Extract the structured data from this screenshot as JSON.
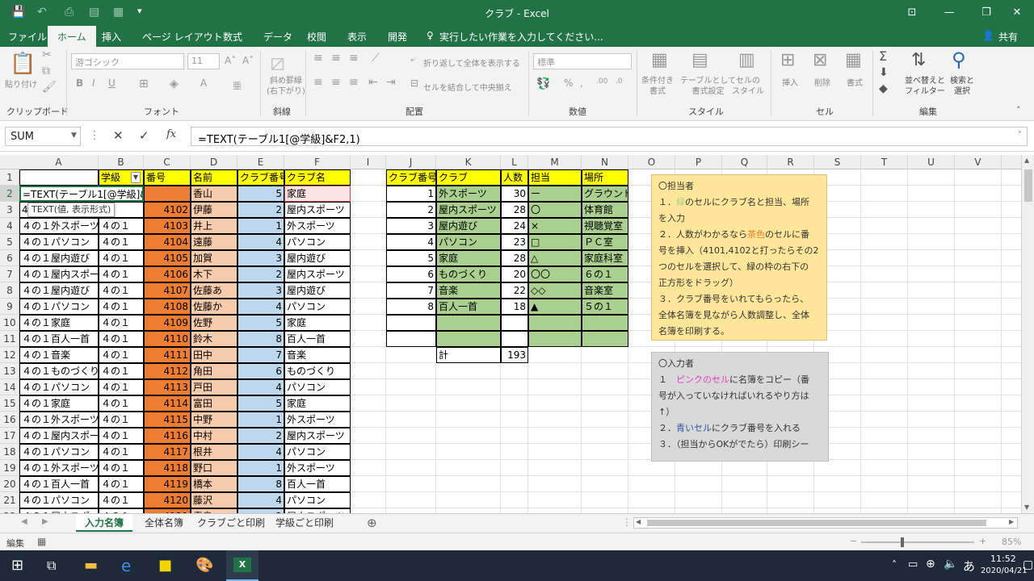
{
  "window": {
    "title": "クラブ - Excel"
  },
  "tabs": [
    "ファイル",
    "ホーム",
    "挿入",
    "ページ レイアウト",
    "数式",
    "データ",
    "校閲",
    "表示",
    "開発"
  ],
  "tell_me": "実行したい作業を入力してください...",
  "share": "共有",
  "ribbon": {
    "paste": "貼り付け",
    "clipboard": "クリップボード",
    "font_name": "游ゴシック",
    "font_size": "11",
    "font_group": "フォント",
    "diag_border": "斜め罫線\n(右下がり)",
    "diag_group": "斜線",
    "wrap": "折り返して全体を表示する",
    "merge": "セルを結合して中央揃え",
    "align_group": "配置",
    "number_format": "標準",
    "number_group": "数値",
    "cond_format": "条件付き\n書式",
    "table_format": "テーブルとして\n書式設定",
    "cell_style": "セルの\nスタイル",
    "style_group": "スタイル",
    "insert": "挿入",
    "delete": "削除",
    "format": "書式",
    "cells_group": "セル",
    "sort": "並べ替えと\nフィルター",
    "find": "検索と\n選択",
    "edit_group": "編集"
  },
  "formula_bar": {
    "name_box": "SUM",
    "formula": "=TEXT(テーブル1[@学級]&F2,1)"
  },
  "columns": [
    "A",
    "B",
    "C",
    "D",
    "E",
    "F",
    "I",
    "J",
    "K",
    "L",
    "M",
    "N",
    "O",
    "P",
    "Q",
    "R",
    "S",
    "T",
    "U",
    "V"
  ],
  "rows": [
    "1",
    "2",
    "3",
    "4",
    "5",
    "6",
    "7",
    "8",
    "9",
    "10",
    "11",
    "12",
    "13",
    "14",
    "15",
    "16",
    "17",
    "18",
    "19",
    "20",
    "21",
    "22"
  ],
  "table1": {
    "headers": [
      "",
      "学級",
      "番号",
      "名前",
      "クラブ番号",
      "クラブ名"
    ],
    "editing_cell": "=TEXT(テーブル1[@学級]&F2,1)",
    "tooltip": "TEXT(値, 表示形式)",
    "row2": [
      "",
      "",
      "",
      "香山",
      "5",
      "家庭"
    ],
    "rows": [
      [
        "4",
        "",
        "4102",
        "伊藤",
        "2",
        "屋内スポーツ"
      ],
      [
        "４の１外スポーツ",
        "４の１",
        "4103",
        "井上",
        "1",
        "外スポーツ"
      ],
      [
        "４の１パソコン",
        "４の１",
        "4104",
        "遠藤",
        "4",
        "パソコン"
      ],
      [
        "４の１屋内遊び",
        "４の１",
        "4105",
        "加賀",
        "3",
        "屋内遊び"
      ],
      [
        "４の１屋内スポーツ",
        "４の１",
        "4106",
        "木下",
        "2",
        "屋内スポーツ"
      ],
      [
        "４の１屋内遊び",
        "４の１",
        "4107",
        "佐藤あ",
        "3",
        "屋内遊び"
      ],
      [
        "４の１パソコン",
        "４の１",
        "4108",
        "佐藤か",
        "4",
        "パソコン"
      ],
      [
        "４の１家庭",
        "４の１",
        "4109",
        "佐野",
        "5",
        "家庭"
      ],
      [
        "４の１百人一首",
        "４の１",
        "4110",
        "鈴木",
        "8",
        "百人一首"
      ],
      [
        "４の１音楽",
        "４の１",
        "4111",
        "田中",
        "7",
        "音楽"
      ],
      [
        "４の１ものづくり",
        "４の１",
        "4112",
        "角田",
        "6",
        "ものづくり"
      ],
      [
        "４の１パソコン",
        "４の１",
        "4113",
        "戸田",
        "4",
        "パソコン"
      ],
      [
        "４の１家庭",
        "４の１",
        "4114",
        "富田",
        "5",
        "家庭"
      ],
      [
        "４の１外スポーツ",
        "４の１",
        "4115",
        "中野",
        "1",
        "外スポーツ"
      ],
      [
        "４の１屋内スポーツ",
        "４の１",
        "4116",
        "中村",
        "2",
        "屋内スポーツ"
      ],
      [
        "４の１パソコン",
        "４の１",
        "4117",
        "根井",
        "4",
        "パソコン"
      ],
      [
        "４の１外スポーツ",
        "４の１",
        "4118",
        "野口",
        "1",
        "外スポーツ"
      ],
      [
        "４の１百人一首",
        "４の１",
        "4119",
        "橋本",
        "8",
        "百人一首"
      ],
      [
        "４の１パソコン",
        "４の１",
        "4120",
        "藤沢",
        "4",
        "パソコン"
      ],
      [
        "４の１屋内スポーツ",
        "４の１",
        "4121",
        "青島",
        "2",
        "屋内スポーツ"
      ]
    ]
  },
  "club_table": {
    "headers": [
      "クラブ番号",
      "クラブ",
      "人数",
      "担当",
      "場所"
    ],
    "rows": [
      [
        "1",
        "外スポーツ",
        "30",
        "ー",
        "グラウンド"
      ],
      [
        "2",
        "屋内スポーツ",
        "28",
        "〇",
        "体育館"
      ],
      [
        "3",
        "屋内遊び",
        "24",
        "×",
        "視聴覚室"
      ],
      [
        "4",
        "パソコン",
        "23",
        "□",
        "ＰＣ室"
      ],
      [
        "5",
        "家庭",
        "28",
        "△",
        "家庭科室"
      ],
      [
        "6",
        "ものづくり",
        "20",
        "〇〇",
        "６の１"
      ],
      [
        "7",
        "音楽",
        "22",
        "◇◇",
        "音楽室"
      ],
      [
        "8",
        "百人一首",
        "18",
        "▲",
        "５の１"
      ],
      [
        "",
        "",
        "",
        "",
        ""
      ],
      [
        "",
        "",
        "",
        "",
        ""
      ]
    ],
    "total_label": "計",
    "total_value": "193"
  },
  "note1": {
    "title": "〇担当者",
    "l1a": "１．",
    "l1b": "緑",
    "l1c": "のセルにクラブ名と担当、場所",
    "l2": "を入力",
    "l3a": "２．人数がわかるなら",
    "l3b": "茶色",
    "l3c": "のセルに番",
    "l4": "号を挿入（4101,4102と打ったらその2",
    "l5": "つのセルを選択して、緑の枠の右下の",
    "l6": "正方形をドラッグ）",
    "l7": "３．クラブ番号をいれてもらったら、",
    "l8": "全体名簿を見ながら人数調整し、全体",
    "l9": "名簿を印刷する。"
  },
  "note2": {
    "title": "〇入力者",
    "l1a": "１　",
    "l1b": "ピンクのセル",
    "l1c": "に名簿をコピー（番",
    "l2": "号が入っていなければいれるやり方は",
    "l3": "↑）",
    "l4a": "２．",
    "l4b": "青いセル",
    "l4c": "にクラブ番号を入れる",
    "l5": "３．（担当からOKがでたら）印刷シー"
  },
  "sheets": [
    "入力名簿",
    "全体名簿",
    "クラブごと印刷",
    "学級ごと印刷"
  ],
  "status": {
    "mode": "編集",
    "zoom": "85%"
  },
  "taskbar": {
    "time": "11:52",
    "date": "2020/04/21",
    "ime": "あ"
  },
  "colors": {
    "excel_green": "#217346",
    "yellow": "#ffff00",
    "orange": "#ed7d31",
    "peach": "#f8cbad",
    "blue": "#bdd7ee",
    "pink": "#fce4e4",
    "green": "#a9d08e",
    "note1": "#ffe699",
    "note2": "#d9d9d9"
  }
}
